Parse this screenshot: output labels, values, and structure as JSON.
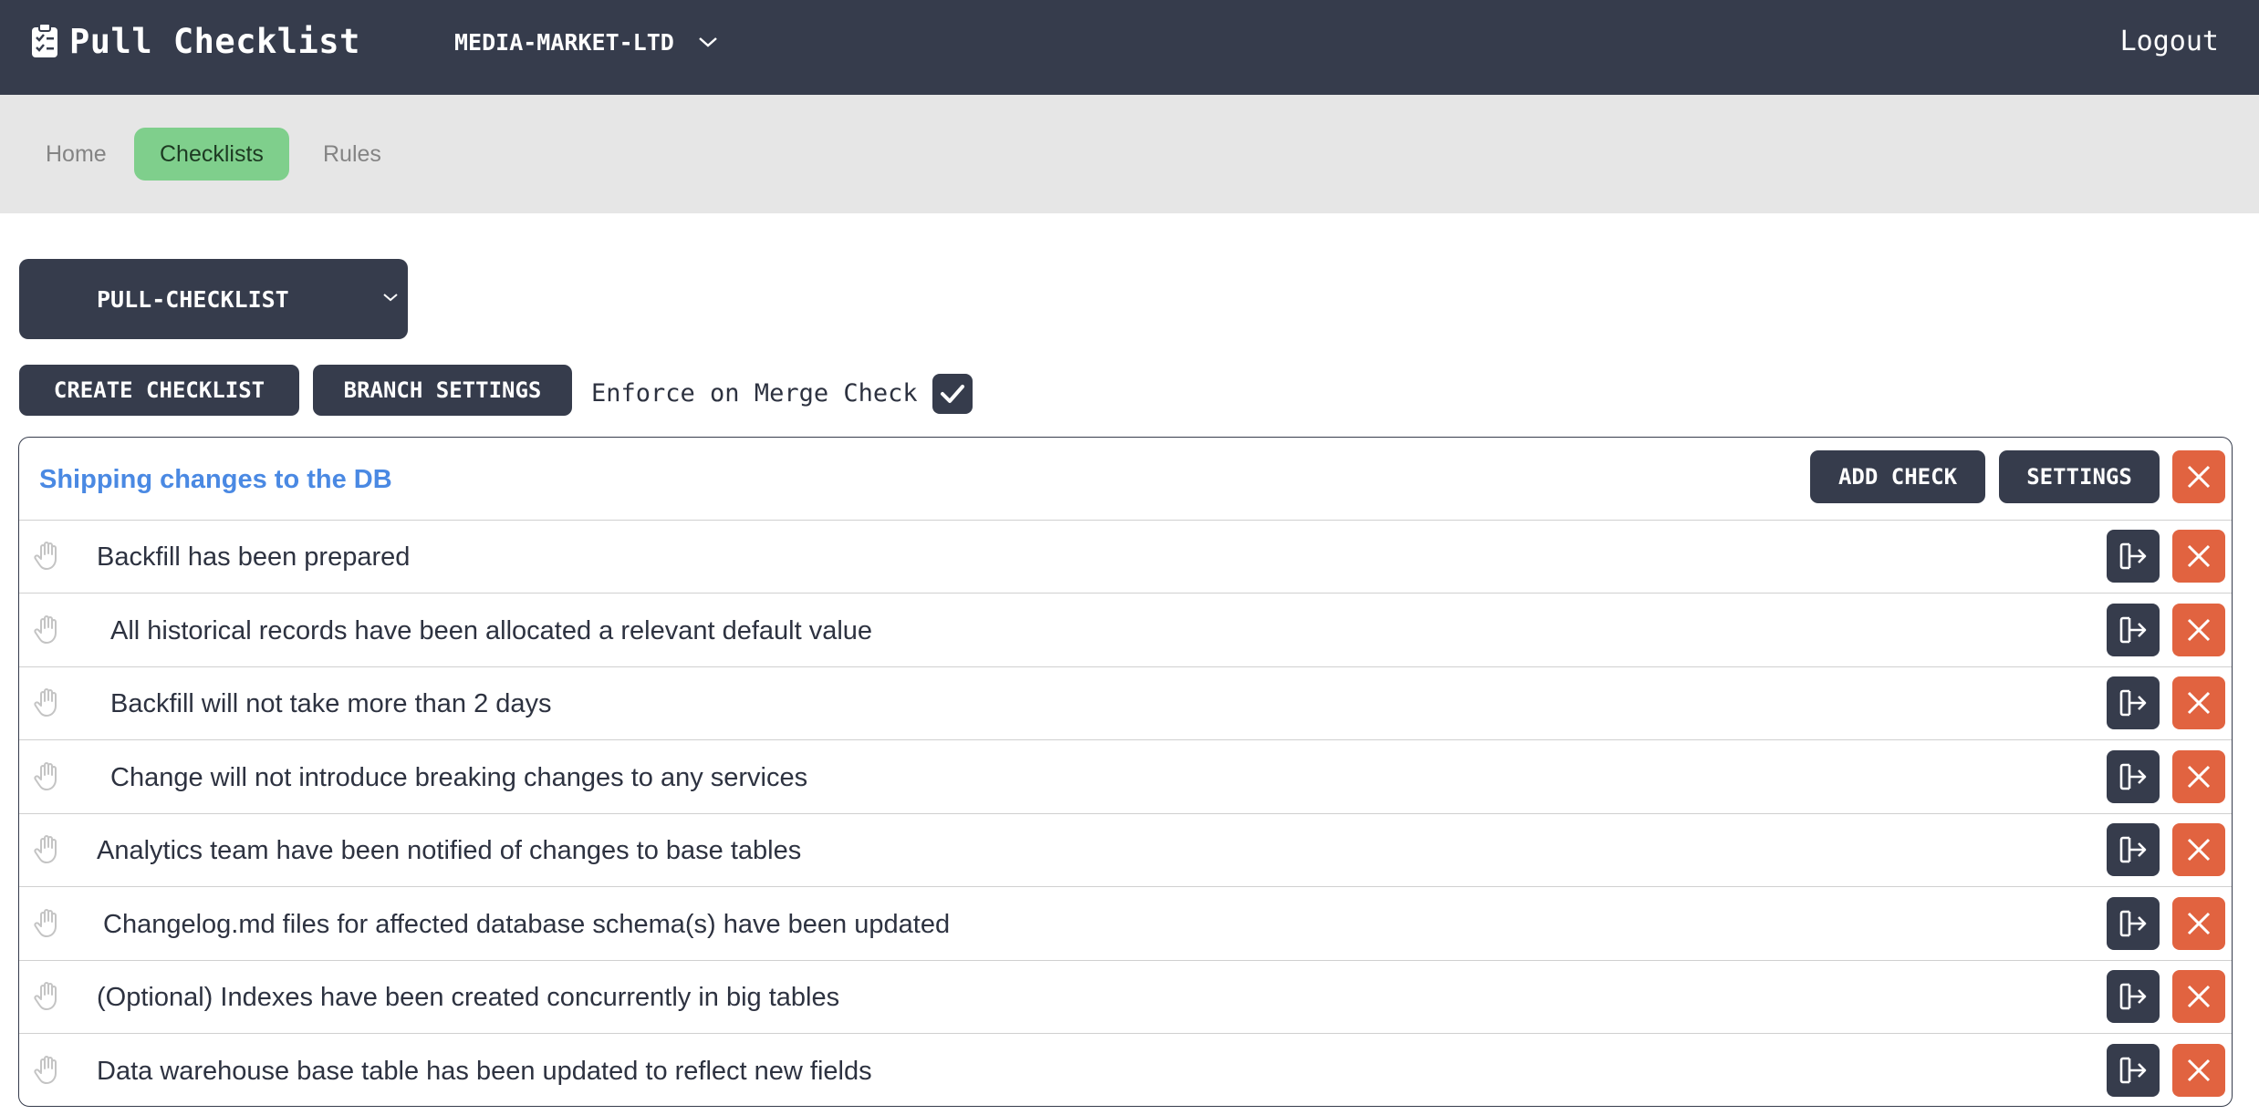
{
  "header": {
    "brand": "Pull Checklist",
    "brand_icon": "clipboard-icon",
    "organization": "MEDIA-MARKET-LTD",
    "logout": "Logout"
  },
  "nav": {
    "items": [
      {
        "label": "Home",
        "active": false
      },
      {
        "label": "Checklists",
        "active": true
      },
      {
        "label": "Rules",
        "active": false
      }
    ]
  },
  "repo_select": {
    "value": "PULL-CHECKLIST"
  },
  "toolbar": {
    "create_checklist": "CREATE CHECKLIST",
    "branch_settings": "BRANCH SETTINGS",
    "enforce_label": "Enforce on Merge Check",
    "enforce_checked": true
  },
  "checklist": {
    "title": "Shipping changes to the DB",
    "add_check": "ADD CHECK",
    "settings": "SETTINGS",
    "items": [
      {
        "text": "Backfill has been prepared"
      },
      {
        "text": "All historical records have been allocated a relevant default value"
      },
      {
        "text": "Backfill will not take more than 2 days"
      },
      {
        "text": "Change will not introduce breaking changes to any services"
      },
      {
        "text": "Analytics team have been notified of changes to base tables"
      },
      {
        "text": "Changelog.md files for affected database schema(s) have been updated"
      },
      {
        "text": "(Optional) Indexes have been created concurrently in big tables"
      },
      {
        "text": "Data warehouse base table has been updated to reflect new fields"
      }
    ]
  },
  "colors": {
    "header_bg": "#363c4c",
    "nav_active": "#7fcf8c",
    "title_blue": "#4a89e3",
    "danger": "#e16340"
  }
}
